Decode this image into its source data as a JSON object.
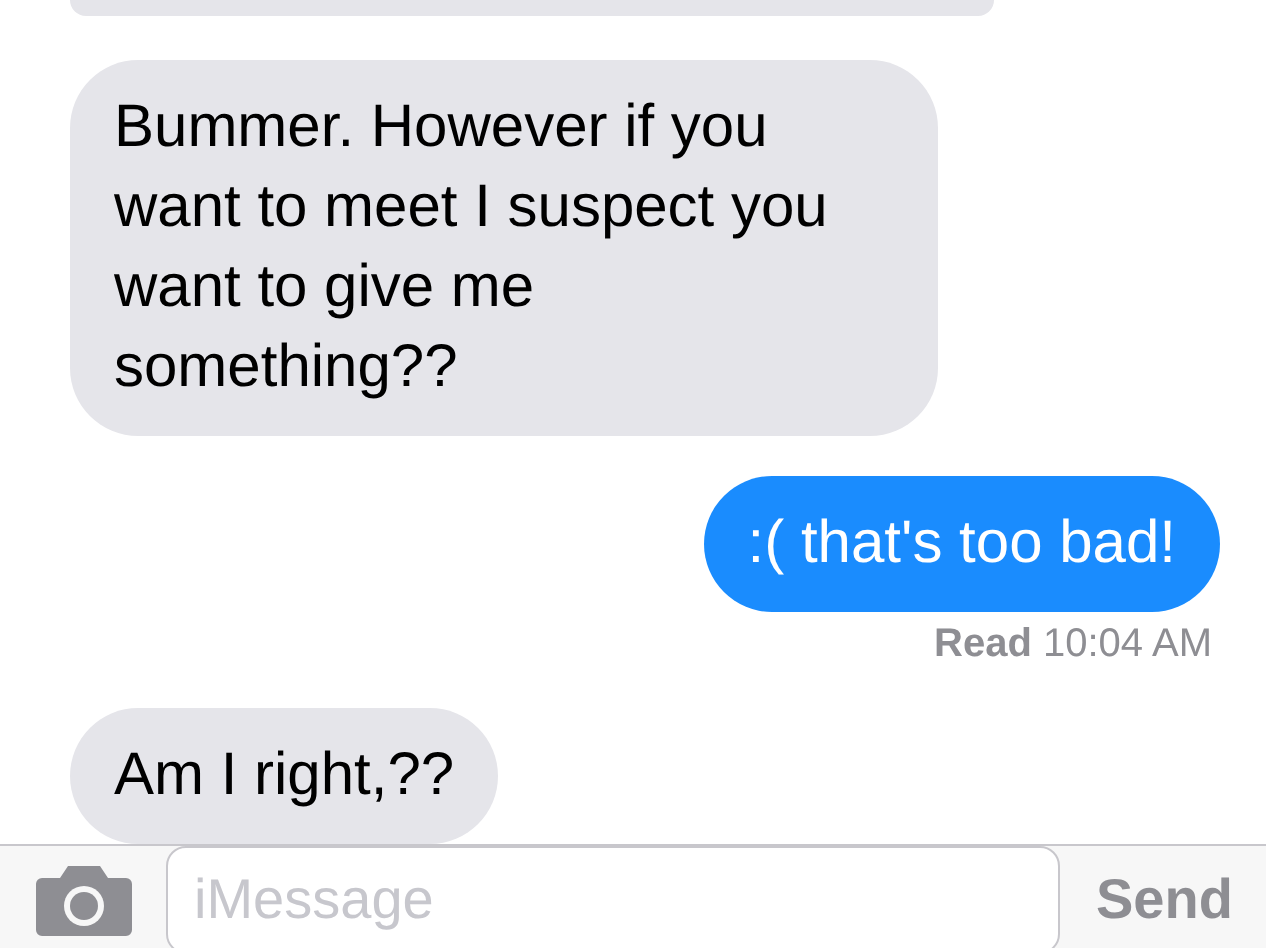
{
  "messages": [
    {
      "kind": "received"
    },
    {
      "kind": "received",
      "text": "Bummer. However if you want to meet I suspect you want to give me something??"
    },
    {
      "kind": "sent",
      "text": ":( that's too bad!",
      "receipt": {
        "label": "Read",
        "time": "10:04 AM"
      }
    },
    {
      "kind": "received",
      "text": "Am I right,??"
    }
  ],
  "composer": {
    "placeholder": "iMessage",
    "send": "Send"
  }
}
